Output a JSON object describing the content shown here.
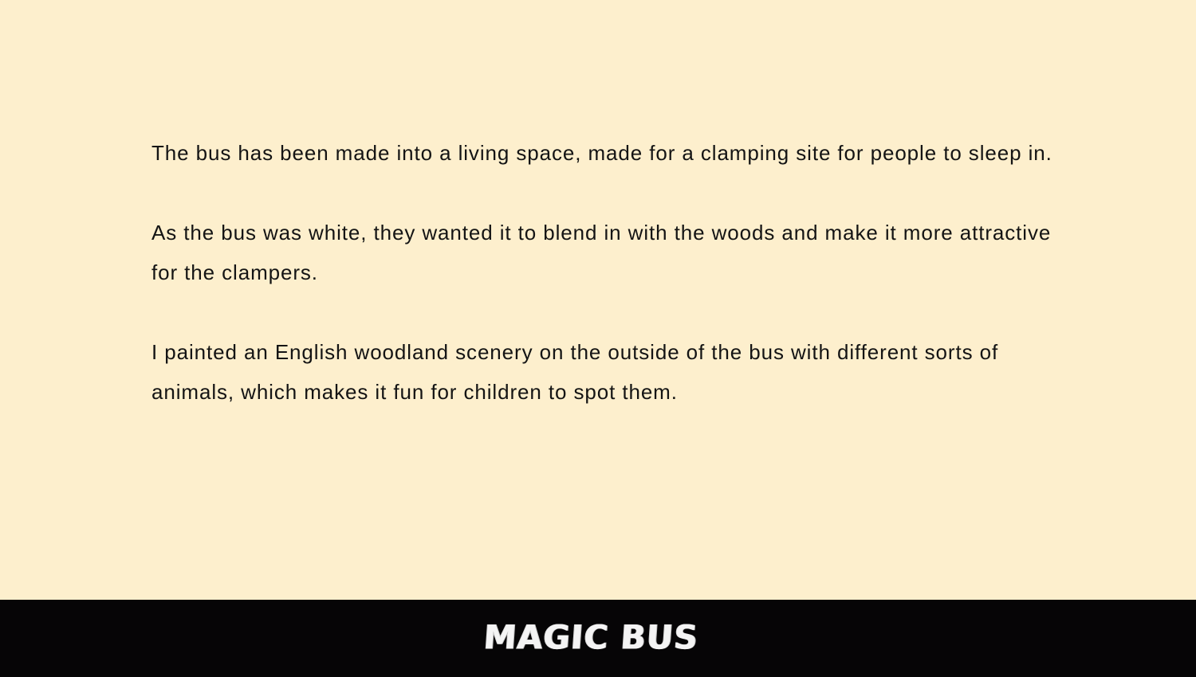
{
  "content": {
    "paragraphs": [
      "The bus has been made into a living space, made for a clamping site for people to sleep in.",
      "As the bus was white, they wanted it to blend in with the woods and make it more attractive for the clampers.",
      "I painted an English woodland scenery on the outside of the bus with different sorts of animals, which makes it fun for children to spot them."
    ]
  },
  "footer": {
    "logo_text": "MAGIC BUS"
  },
  "colors": {
    "background": "#fdefcd",
    "text": "#141414",
    "footer_background": "#060506",
    "logo": "#f4f4f4"
  }
}
